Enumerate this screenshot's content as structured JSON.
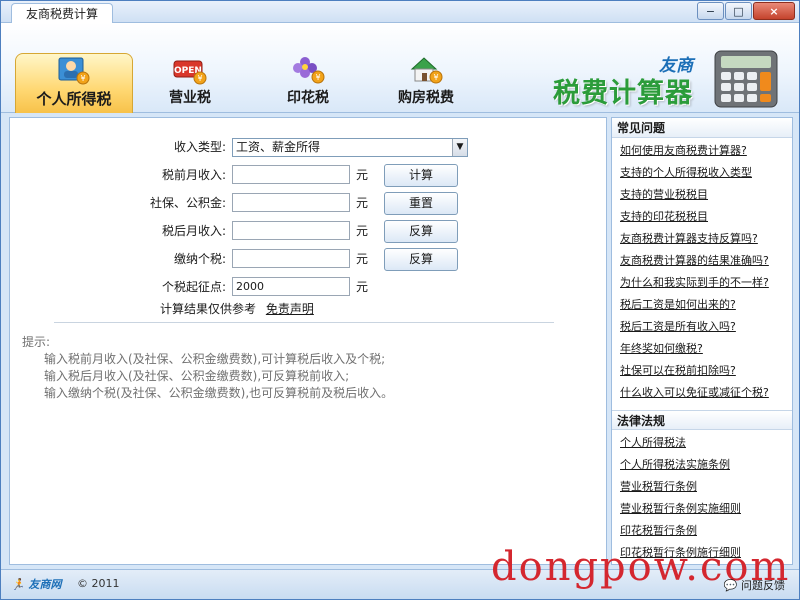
{
  "window": {
    "title": "友商税费计算",
    "minimize": "−",
    "maximize": "□",
    "close": "×"
  },
  "tabs": [
    {
      "label": "个人所得税",
      "icon": "person-card-icon",
      "active": true
    },
    {
      "label": "营业税",
      "icon": "open-sign-icon",
      "active": false
    },
    {
      "label": "印花税",
      "icon": "flower-stamp-icon",
      "active": false
    },
    {
      "label": "购房税费",
      "icon": "house-icon",
      "active": false
    }
  ],
  "brand": {
    "sub": "友商",
    "main": "税费计算器",
    "icon": "calculator-icon"
  },
  "form": {
    "income_type_label": "收入类型:",
    "income_type_value": "工资、薪金所得",
    "pretax_label": "税前月收入:",
    "pretax_value": "",
    "social_label": "社保、公积金:",
    "social_value": "",
    "aftertax_label": "税后月收入:",
    "aftertax_value": "",
    "tax_label": "缴纳个税:",
    "tax_value": "",
    "threshold_label": "个税起征点:",
    "threshold_value": "2000",
    "unit": "元",
    "calc_button": "计算",
    "reset_button": "重置",
    "reverse_button_1": "反算",
    "reverse_button_2": "反算",
    "note": "计算结果仅供参考",
    "disclaimer_link": "免责声明"
  },
  "hints": {
    "title": "提示:",
    "lines": [
      "输入税前月收入(及社保、公积金缴费数),可计算税后收入及个税;",
      "输入税后月收入(及社保、公积金缴费数),可反算税前收入;",
      "输入缴纳个税(及社保、公积金缴费数),也可反算税前及税后收入。"
    ]
  },
  "faq": {
    "title": "常见问题",
    "items": [
      "如何使用友商税费计算器?",
      "支持的个人所得税收入类型",
      "支持的营业税税目",
      "支持的印花税税目",
      "友商税费计算器支持反算吗?",
      "友商税费计算器的结果准确吗?",
      "为什么和我实际到手的不一样?",
      "税后工资是如何出来的?",
      "税后工资是所有收入吗?",
      "年终奖如何缴税?",
      "社保可以在税前扣除吗?",
      "什么收入可以免征或减征个税?"
    ]
  },
  "laws": {
    "title": "法律法规",
    "items": [
      "个人所得税法",
      "个人所得税法实施条例",
      "营业税暂行条例",
      "营业税暂行条例实施细则",
      "印花税暂行条例",
      "印花税暂行条例施行细则"
    ]
  },
  "status": {
    "logo": "友商网",
    "copyright": "© 2011",
    "feedback": "问题反馈",
    "watermark": "dongpow.com"
  }
}
